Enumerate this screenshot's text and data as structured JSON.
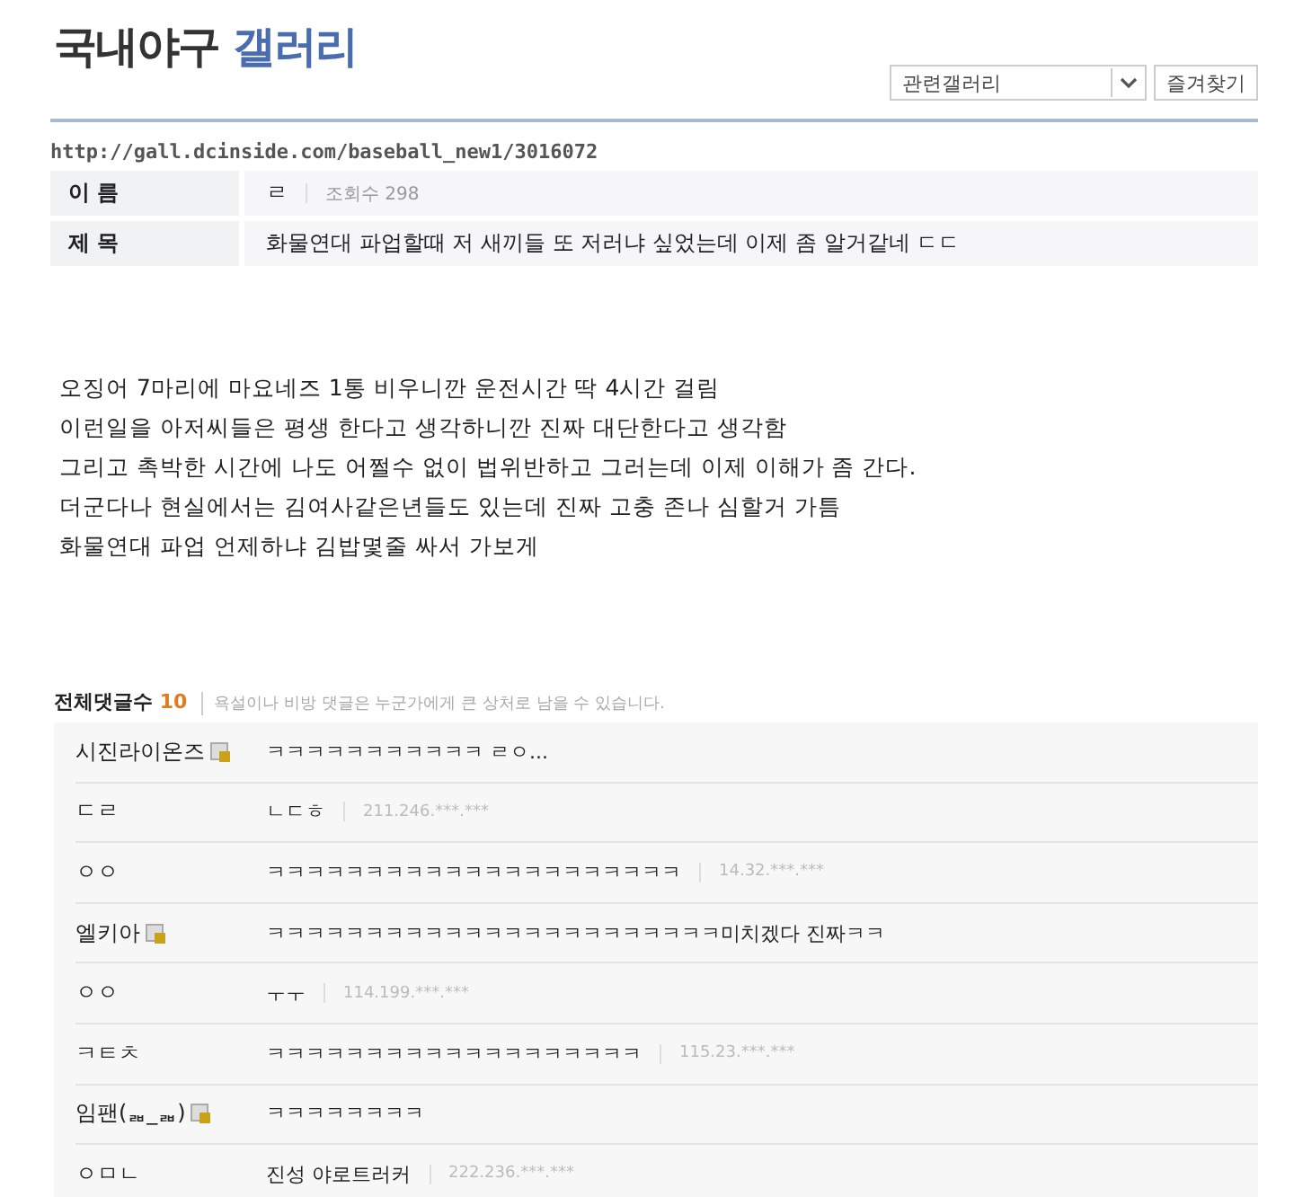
{
  "header": {
    "title": "국내야구",
    "title_accent": "갤러리",
    "related_select": "관련갤러리",
    "favorites_button": "즐겨찾기"
  },
  "post": {
    "url": "http://gall.dcinside.com/baseball_new1/3016072",
    "name_label": "이 름",
    "name": "ㄹ",
    "views_label": "조회수",
    "views": "298",
    "subject_label": "제 목",
    "subject": "화물연대 파업할때 저 새끼들 또 저러냐 싶었는데 이제 좀 알거같네 ㄷㄷ",
    "body": [
      "오징어 7마리에 마요네즈 1통 비우니깐 운전시간 딱 4시간 걸림",
      "이런일을 아저씨들은 평생 한다고 생각하니깐 진짜 대단한다고 생각함",
      "그리고 촉박한 시간에 나도 어쩔수 없이 법위반하고 그러는데 이제 이해가 좀 간다.",
      "더군다나 현실에서는 김여사같은년들도 있는데 진짜 고충 존나 심할거 가틈",
      "화물연대 파업 언제하냐 김밥몇줄 싸서 가보게"
    ]
  },
  "comments_header": {
    "label": "전체댓글수",
    "count": "10",
    "notice": "욕설이나 비방 댓글은 누군가에게 큰 상처로 남을 수 있습니다."
  },
  "comments": [
    {
      "name": "시진라이온즈",
      "member": true,
      "text": "ㅋㅋㅋㅋㅋㅋㅋㅋㅋㅋㅋ ㄹㅇ..."
    },
    {
      "name": "ㄷㄹ",
      "member": false,
      "text": "ㄴㄷㅎ",
      "ip": "211.246.***.***"
    },
    {
      "name": "ㅇㅇ",
      "member": false,
      "text": "ㅋㅋㅋㅋㅋㅋㅋㅋㅋㅋㅋㅋㅋㅋㅋㅋㅋㅋㅋㅋㅋ",
      "ip": "14.32.***.***"
    },
    {
      "name": "엘키아",
      "member": true,
      "text": "ㅋㅋㅋㅋㅋㅋㅋㅋㅋㅋㅋㅋㅋㅋㅋㅋㅋㅋㅋㅋㅋㅋㅋ미치겠다 진짜ㅋㅋ"
    },
    {
      "name": "ㅇㅇ",
      "member": false,
      "text": "ㅜㅜ",
      "ip": "114.199.***.***"
    },
    {
      "name": "ㅋㅌㅊ",
      "member": false,
      "text": "ㅋㅋㅋㅋㅋㅋㅋㅋㅋㅋㅋㅋㅋㅋㅋㅋㅋㅋㅋ",
      "ip": "115.23.***.***"
    },
    {
      "name": "임팬(ᆲ_ᆲ)",
      "member": true,
      "text": "ㅋㅋㅋㅋㅋㅋㅋㅋ"
    },
    {
      "name": "ㅇㅁㄴ",
      "member": false,
      "text": "진성 야로트러커",
      "ip": "222.236.***.***"
    }
  ]
}
